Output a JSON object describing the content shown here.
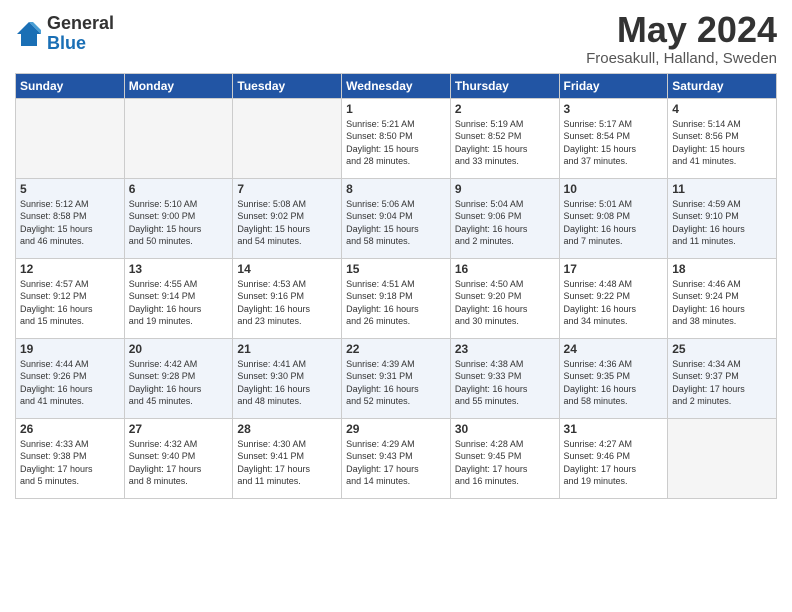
{
  "header": {
    "logo_general": "General",
    "logo_blue": "Blue",
    "month_title": "May 2024",
    "location": "Froesakull, Halland, Sweden"
  },
  "weekdays": [
    "Sunday",
    "Monday",
    "Tuesday",
    "Wednesday",
    "Thursday",
    "Friday",
    "Saturday"
  ],
  "rows": [
    [
      {
        "day": "",
        "info": ""
      },
      {
        "day": "",
        "info": ""
      },
      {
        "day": "",
        "info": ""
      },
      {
        "day": "1",
        "info": "Sunrise: 5:21 AM\nSunset: 8:50 PM\nDaylight: 15 hours\nand 28 minutes."
      },
      {
        "day": "2",
        "info": "Sunrise: 5:19 AM\nSunset: 8:52 PM\nDaylight: 15 hours\nand 33 minutes."
      },
      {
        "day": "3",
        "info": "Sunrise: 5:17 AM\nSunset: 8:54 PM\nDaylight: 15 hours\nand 37 minutes."
      },
      {
        "day": "4",
        "info": "Sunrise: 5:14 AM\nSunset: 8:56 PM\nDaylight: 15 hours\nand 41 minutes."
      }
    ],
    [
      {
        "day": "5",
        "info": "Sunrise: 5:12 AM\nSunset: 8:58 PM\nDaylight: 15 hours\nand 46 minutes."
      },
      {
        "day": "6",
        "info": "Sunrise: 5:10 AM\nSunset: 9:00 PM\nDaylight: 15 hours\nand 50 minutes."
      },
      {
        "day": "7",
        "info": "Sunrise: 5:08 AM\nSunset: 9:02 PM\nDaylight: 15 hours\nand 54 minutes."
      },
      {
        "day": "8",
        "info": "Sunrise: 5:06 AM\nSunset: 9:04 PM\nDaylight: 15 hours\nand 58 minutes."
      },
      {
        "day": "9",
        "info": "Sunrise: 5:04 AM\nSunset: 9:06 PM\nDaylight: 16 hours\nand 2 minutes."
      },
      {
        "day": "10",
        "info": "Sunrise: 5:01 AM\nSunset: 9:08 PM\nDaylight: 16 hours\nand 7 minutes."
      },
      {
        "day": "11",
        "info": "Sunrise: 4:59 AM\nSunset: 9:10 PM\nDaylight: 16 hours\nand 11 minutes."
      }
    ],
    [
      {
        "day": "12",
        "info": "Sunrise: 4:57 AM\nSunset: 9:12 PM\nDaylight: 16 hours\nand 15 minutes."
      },
      {
        "day": "13",
        "info": "Sunrise: 4:55 AM\nSunset: 9:14 PM\nDaylight: 16 hours\nand 19 minutes."
      },
      {
        "day": "14",
        "info": "Sunrise: 4:53 AM\nSunset: 9:16 PM\nDaylight: 16 hours\nand 23 minutes."
      },
      {
        "day": "15",
        "info": "Sunrise: 4:51 AM\nSunset: 9:18 PM\nDaylight: 16 hours\nand 26 minutes."
      },
      {
        "day": "16",
        "info": "Sunrise: 4:50 AM\nSunset: 9:20 PM\nDaylight: 16 hours\nand 30 minutes."
      },
      {
        "day": "17",
        "info": "Sunrise: 4:48 AM\nSunset: 9:22 PM\nDaylight: 16 hours\nand 34 minutes."
      },
      {
        "day": "18",
        "info": "Sunrise: 4:46 AM\nSunset: 9:24 PM\nDaylight: 16 hours\nand 38 minutes."
      }
    ],
    [
      {
        "day": "19",
        "info": "Sunrise: 4:44 AM\nSunset: 9:26 PM\nDaylight: 16 hours\nand 41 minutes."
      },
      {
        "day": "20",
        "info": "Sunrise: 4:42 AM\nSunset: 9:28 PM\nDaylight: 16 hours\nand 45 minutes."
      },
      {
        "day": "21",
        "info": "Sunrise: 4:41 AM\nSunset: 9:30 PM\nDaylight: 16 hours\nand 48 minutes."
      },
      {
        "day": "22",
        "info": "Sunrise: 4:39 AM\nSunset: 9:31 PM\nDaylight: 16 hours\nand 52 minutes."
      },
      {
        "day": "23",
        "info": "Sunrise: 4:38 AM\nSunset: 9:33 PM\nDaylight: 16 hours\nand 55 minutes."
      },
      {
        "day": "24",
        "info": "Sunrise: 4:36 AM\nSunset: 9:35 PM\nDaylight: 16 hours\nand 58 minutes."
      },
      {
        "day": "25",
        "info": "Sunrise: 4:34 AM\nSunset: 9:37 PM\nDaylight: 17 hours\nand 2 minutes."
      }
    ],
    [
      {
        "day": "26",
        "info": "Sunrise: 4:33 AM\nSunset: 9:38 PM\nDaylight: 17 hours\nand 5 minutes."
      },
      {
        "day": "27",
        "info": "Sunrise: 4:32 AM\nSunset: 9:40 PM\nDaylight: 17 hours\nand 8 minutes."
      },
      {
        "day": "28",
        "info": "Sunrise: 4:30 AM\nSunset: 9:41 PM\nDaylight: 17 hours\nand 11 minutes."
      },
      {
        "day": "29",
        "info": "Sunrise: 4:29 AM\nSunset: 9:43 PM\nDaylight: 17 hours\nand 14 minutes."
      },
      {
        "day": "30",
        "info": "Sunrise: 4:28 AM\nSunset: 9:45 PM\nDaylight: 17 hours\nand 16 minutes."
      },
      {
        "day": "31",
        "info": "Sunrise: 4:27 AM\nSunset: 9:46 PM\nDaylight: 17 hours\nand 19 minutes."
      },
      {
        "day": "",
        "info": ""
      }
    ]
  ]
}
